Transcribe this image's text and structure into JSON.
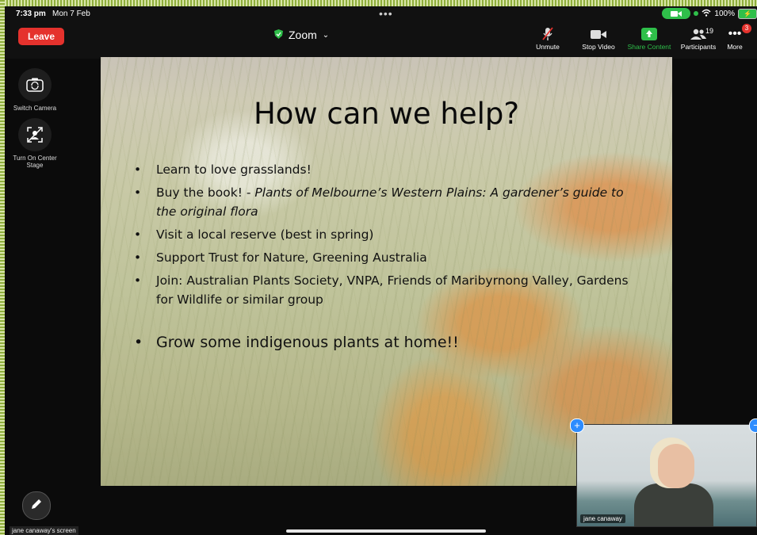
{
  "status": {
    "time": "7:33 pm",
    "date": "Mon 7 Feb",
    "battery": "100%"
  },
  "toolbar": {
    "leave_label": "Leave",
    "app_title": "Zoom",
    "unmute_label": "Unmute",
    "stop_video_label": "Stop Video",
    "share_label": "Share Content",
    "participants_label": "Participants",
    "participants_count": "19",
    "more_label": "More",
    "more_badge": "3"
  },
  "side": {
    "switch_camera": "Switch Camera",
    "center_stage": "Turn On Center Stage"
  },
  "slide": {
    "title": "How can we help?",
    "bullets": [
      "Learn to love grasslands!",
      "Buy the book! - ",
      "Plants of Melbourne’s Western Plains: A gardener’s guide to the original flora",
      "Visit a local reserve (best in spring)",
      "Support Trust for Nature, Greening Australia",
      "Join: Australian Plants Society, VNPA, Friends of Maribyrnong Valley, Gardens for Wildlife or similar group",
      "Grow some indigenous plants at home!!"
    ]
  },
  "self_view": {
    "name": "jane canaway"
  },
  "share": {
    "label": "jane canaway's screen"
  },
  "colors": {
    "leave": "#e5322d",
    "share_green": "#2fbf4a",
    "accent_blue": "#2d8cff"
  }
}
